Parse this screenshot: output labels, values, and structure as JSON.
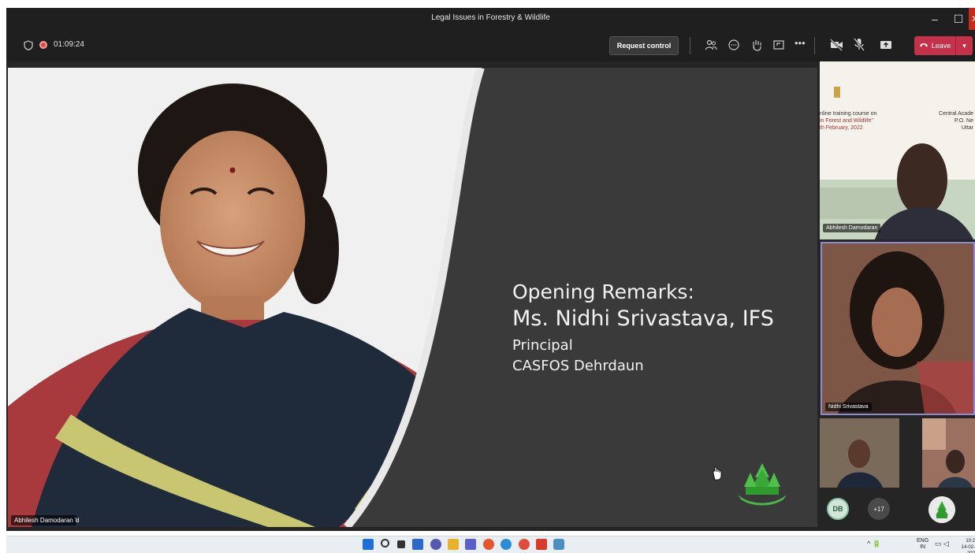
{
  "window": {
    "title": "Legal Issues in Forestry & Wildlife",
    "minimize": "–",
    "maximize": "☐",
    "close": "✕"
  },
  "toolbar": {
    "timer": "01:09:24",
    "request_control_label": "Request control",
    "leave_label": "Leave",
    "icons": [
      "people-icon",
      "chat-icon",
      "raise-hand-icon",
      "share-tray-icon",
      "more-icon",
      "camera-off-icon",
      "mic-off-icon",
      "share-screen-icon"
    ]
  },
  "slide": {
    "heading": "Opening Remarks:",
    "speaker_name": "Ms. Nidhi Srivastava, IFS",
    "speaker_title": "Principal",
    "speaker_org": "CASFOS Dehrdaun",
    "presenter_label": "Abhilesh Damodaran"
  },
  "participants": {
    "tile1": {
      "name": "Abhilesh Damodaran",
      "background_lines": [
        "nline training course on",
        "in Forest and Wildlife\"",
        "th February, 2022"
      ],
      "background_right": [
        "Central Acade",
        "P.O. Ne",
        "Uttar"
      ]
    },
    "tile2": {
      "name": "Nidhi Srivastava"
    },
    "avatar_initials": "DB",
    "overflow_count": "+17"
  },
  "taskbar": {
    "tray_lang_1": "ENG",
    "tray_lang_2": "IN",
    "clock_time": "10:2",
    "clock_date": "14-02-202"
  },
  "colors": {
    "leave_red": "#c4314b",
    "titlebar": "#1f1f1f",
    "slide_bg": "#3a3a3a",
    "active_speaker_border": "#8c8cd6"
  }
}
